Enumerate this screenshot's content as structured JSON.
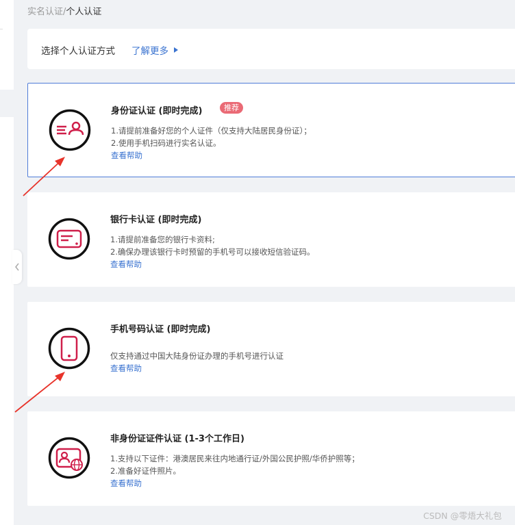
{
  "breadcrumb": {
    "parent": "实名认证",
    "sep": "/",
    "current": "个人认证"
  },
  "header": {
    "title": "选择个人认证方式",
    "more": "了解更多"
  },
  "cards": [
    {
      "title": "身份证认证 (即时完成)",
      "badge": "推荐",
      "lines": [
        "1.请提前准备好您的个人证件（仅支持大陆居民身份证）；",
        "2.使用手机扫码进行实名认证。"
      ],
      "help": "查看帮助"
    },
    {
      "title": "银行卡认证 (即时完成)",
      "lines": [
        "1.请提前准备您的银行卡资料;",
        "2.确保办理该银行卡时预留的手机号可以接收短信验证码。"
      ],
      "help": "查看帮助"
    },
    {
      "title": "手机号码认证 (即时完成)",
      "lines": [
        "仅支持通过中国大陆身份证办理的手机号进行认证"
      ],
      "help": "查看帮助"
    },
    {
      "title": "非身份证证件认证 (1-3个工作日)",
      "lines": [
        "1.支持以下证件：港澳居民来往内地通行证/外国公民护照/华侨护照等；",
        "2.准备好证件照片。"
      ],
      "help": "查看帮助"
    }
  ],
  "watermark": "CSDN @零焐大礼包",
  "colors": {
    "accent": "#3a73d0",
    "icon_red": "#cf1f4a",
    "badge": "#ea6a75",
    "active_border": "#4e7bd8"
  }
}
